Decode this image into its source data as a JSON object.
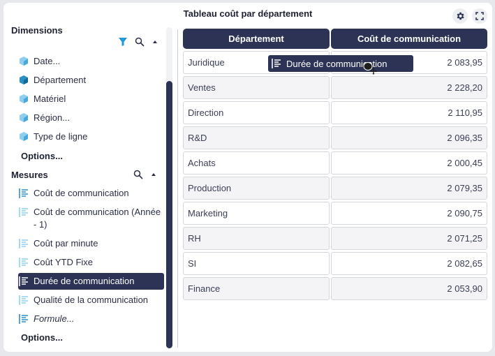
{
  "title": "Tableau coût par département",
  "toolbar": {
    "settings_icon": "gear-icon",
    "fullscreen_icon": "fullscreen-icon"
  },
  "dimensions": {
    "label": "Dimensions",
    "items": [
      {
        "label": "Date...",
        "icon": "cube-icon"
      },
      {
        "label": "Département",
        "icon": "cube-icon"
      },
      {
        "label": "Matériel",
        "icon": "cube-icon"
      },
      {
        "label": "Région...",
        "icon": "cube-icon"
      },
      {
        "label": "Type de ligne",
        "icon": "cube-icon"
      }
    ],
    "options": "Options..."
  },
  "mesures": {
    "label": "Mesures",
    "items": [
      {
        "label": "Coût de communication",
        "icon": "measure-icon"
      },
      {
        "label": "Coût de communication (Année - 1)",
        "icon": "measure-icon"
      },
      {
        "label": "Coût par minute",
        "icon": "measure-icon"
      },
      {
        "label": "Coût YTD Fixe",
        "icon": "measure-icon"
      },
      {
        "label": "Durée de communication",
        "icon": "measure-icon",
        "selected": true
      },
      {
        "label": "Qualité de la communication",
        "icon": "measure-icon"
      },
      {
        "label": "Formule...",
        "icon": "measure-icon"
      }
    ],
    "options": "Options..."
  },
  "table": {
    "headers": [
      "Département",
      "Coût de communication"
    ],
    "rows": [
      [
        "Juridique",
        "2 083,95"
      ],
      [
        "Ventes",
        "2 228,20"
      ],
      [
        "Direction",
        "2 110,95"
      ],
      [
        "R&D",
        "2 096,35"
      ],
      [
        "Achats",
        "2 000,45"
      ],
      [
        "Production",
        "2 079,35"
      ],
      [
        "Marketing",
        "2 090,75"
      ],
      [
        "RH",
        "2 071,25"
      ],
      [
        "SI",
        "2 082,65"
      ],
      [
        "Finance",
        "2 053,90"
      ]
    ]
  },
  "drag_ghost": {
    "label": "Durée de communication"
  },
  "colors": {
    "accent": "#2c3354",
    "cube": "#4aa8d8",
    "filter": "#1f9ad6"
  }
}
